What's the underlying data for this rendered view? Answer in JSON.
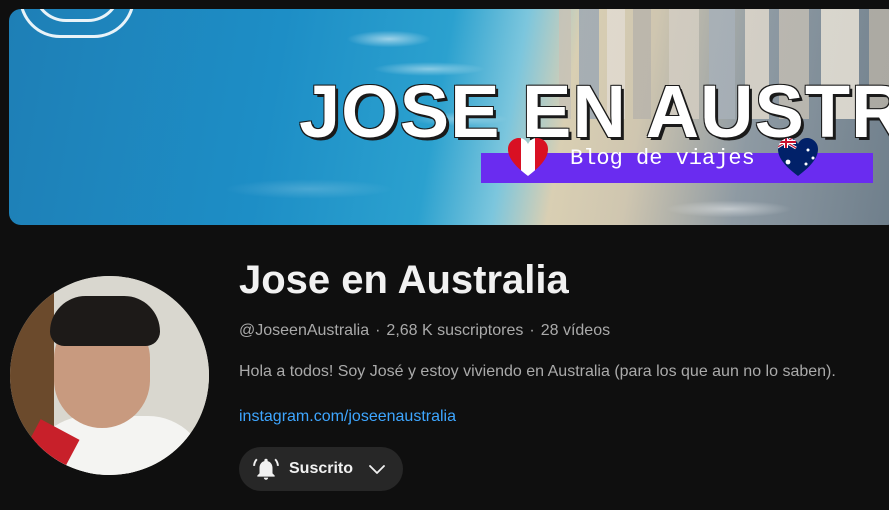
{
  "banner": {
    "title": "JOSE EN AUSTRALIA",
    "subtitle": "Blog de viajes",
    "ribbon_color": "#6a2cf0"
  },
  "channel": {
    "name": "Jose en Australia",
    "handle": "@JoseenAustralia",
    "subscribers": "2,68 K suscriptores",
    "videos": "28 vídeos",
    "separator": "·",
    "description": "Hola a todos! Soy José y estoy viviendo en Australia (para los que aun no lo saben).",
    "link": "instagram.com/joseenaustralia"
  },
  "subscribe_button": {
    "label": "Suscrito",
    "icon": "bell-ringing-icon",
    "chevron_icon": "chevron-down-icon"
  },
  "colors": {
    "background": "#0f0f0f",
    "text_primary": "#f1f1f1",
    "text_secondary": "#aaaaaa",
    "link": "#3ea6ff",
    "button_bg": "#272727"
  }
}
